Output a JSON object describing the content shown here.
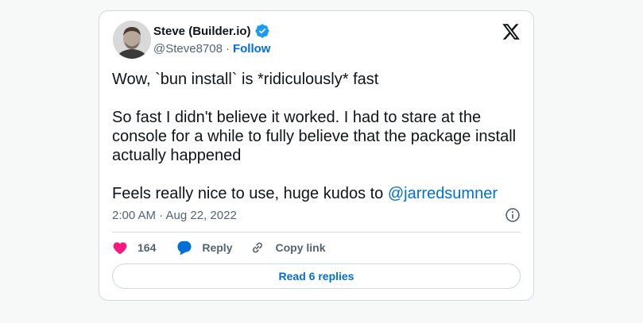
{
  "author": {
    "name": "Steve (Builder.io)",
    "handle": "@Steve8708",
    "follow_label": "Follow",
    "separator": "·"
  },
  "tweet": {
    "line1": "Wow, `bun install` is *ridiculously* fast",
    "paragraph2": "So fast I didn't believe it worked. I had to stare at the console for a while to fully believe that the package install actually happened",
    "paragraph3_prefix": "Feels really nice to use, huge kudos to ",
    "mention": "@jarredsumner",
    "timestamp": "2:00 AM · Aug 22, 2022"
  },
  "actions": {
    "like_count": "164",
    "reply_label": "Reply",
    "copy_label": "Copy link"
  },
  "footer": {
    "read_replies_label": "Read 6 replies"
  },
  "icons": {
    "verified": "verified-badge-icon",
    "x_logo": "x-logo-icon",
    "info": "info-icon",
    "like": "heart-icon",
    "reply": "reply-bubble-icon",
    "copy": "link-icon"
  },
  "colors": {
    "accent": "#006fd6",
    "like": "#f91880",
    "verified": "#1d9bf0",
    "text": "#0f1419",
    "muted": "#536471",
    "border": "#cfd9de"
  }
}
